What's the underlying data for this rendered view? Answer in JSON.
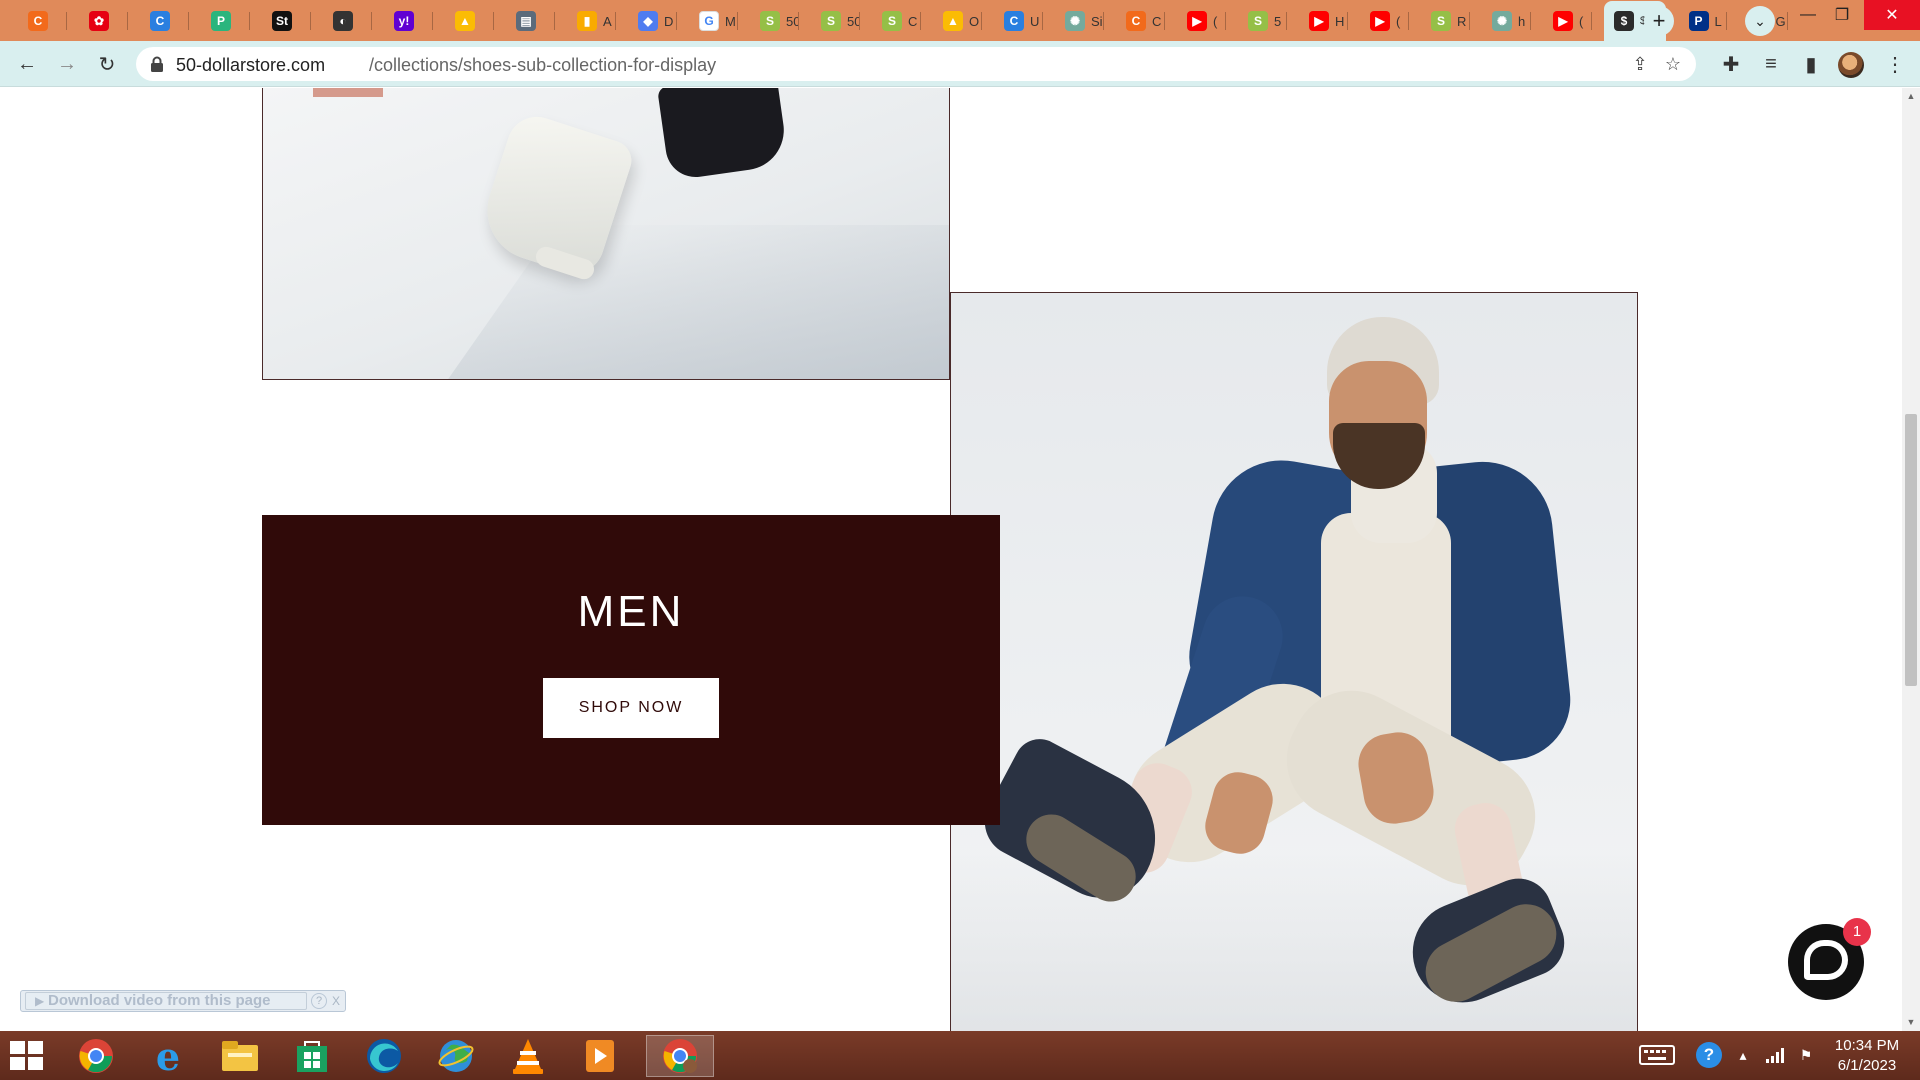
{
  "browser": {
    "tabs": [
      {
        "icon": "canva-icon",
        "title": "",
        "color": "#f26a1b",
        "glyph": "C"
      },
      {
        "icon": "huawei-icon",
        "title": "",
        "color": "#e60012",
        "glyph": "✿"
      },
      {
        "icon": "canva-icon",
        "title": "",
        "color": "#2a7fe0",
        "glyph": "C"
      },
      {
        "icon": "p-icon",
        "title": "",
        "color": "#2ab57d",
        "glyph": "P"
      },
      {
        "icon": "st-icon",
        "title": "",
        "color": "#111111",
        "glyph": "St"
      },
      {
        "icon": "globe-icon",
        "title": "",
        "color": "#333333",
        "glyph": "◐"
      },
      {
        "icon": "yahoo-icon",
        "title": "",
        "color": "#6001d2",
        "glyph": "y!"
      },
      {
        "icon": "google-ads-icon",
        "title": "",
        "color": "#fbbc04",
        "glyph": "▲"
      },
      {
        "icon": "calendar-icon",
        "title": "",
        "color": "#5b6b7b",
        "glyph": "▤"
      },
      {
        "icon": "analytics-icon",
        "title": "A",
        "color": "#f9ab00",
        "glyph": "▮"
      },
      {
        "icon": "tag-icon",
        "title": "D",
        "color": "#4f7cf0",
        "glyph": "◆"
      },
      {
        "icon": "google-icon",
        "title": "M",
        "color": "#ffffff",
        "glyph": "G"
      },
      {
        "icon": "shopify-icon",
        "title": "50",
        "color": "#95bf47",
        "glyph": "S"
      },
      {
        "icon": "shopify-icon",
        "title": "50",
        "color": "#95bf47",
        "glyph": "S"
      },
      {
        "icon": "shopify-icon",
        "title": "C",
        "color": "#95bf47",
        "glyph": "S"
      },
      {
        "icon": "google-ads-icon",
        "title": "O",
        "color": "#fbbc04",
        "glyph": "▲"
      },
      {
        "icon": "canva-icon",
        "title": "U",
        "color": "#2a7fe0",
        "glyph": "C"
      },
      {
        "icon": "openai-icon",
        "title": "Si",
        "color": "#74aa9c",
        "glyph": "✺"
      },
      {
        "icon": "canva-icon",
        "title": "C",
        "color": "#f26a1b",
        "glyph": "C"
      },
      {
        "icon": "youtube-icon",
        "title": "(",
        "color": "#ff0000",
        "glyph": "▶"
      },
      {
        "icon": "shopify-icon",
        "title": "5",
        "color": "#95bf47",
        "glyph": "S"
      },
      {
        "icon": "youtube-icon",
        "title": "H",
        "color": "#ff0000",
        "glyph": "▶"
      },
      {
        "icon": "youtube-icon",
        "title": "(",
        "color": "#ff0000",
        "glyph": "▶"
      },
      {
        "icon": "shopify-icon",
        "title": "R",
        "color": "#95bf47",
        "glyph": "S"
      },
      {
        "icon": "openai-icon",
        "title": "h",
        "color": "#74aa9c",
        "glyph": "✺"
      },
      {
        "icon": "youtube-icon",
        "title": "(",
        "color": "#ff0000",
        "glyph": "▶"
      },
      {
        "icon": "store-icon",
        "title": "$...",
        "color": "#2b2b2b",
        "glyph": "$",
        "active": true
      },
      {
        "icon": "paypal-icon",
        "title": "L",
        "color": "#003087",
        "glyph": "P"
      },
      {
        "icon": "openai-icon",
        "title": "G",
        "color": "#74aa9c",
        "glyph": "✺"
      }
    ],
    "url_host": "50-dollarstore.com",
    "url_path": "/collections/shoes-sub-collection-for-display"
  },
  "hero": {
    "title": "MEN",
    "button_label": "SHOP NOW"
  },
  "download_bar": {
    "label": "Download video from this page",
    "help": "?",
    "close": "X"
  },
  "chat": {
    "badge_count": "1"
  },
  "taskbar": {
    "apps": [
      "chrome-icon",
      "internet-explorer-icon",
      "file-explorer-icon",
      "store-icon",
      "edge-icon",
      "globe-app-icon",
      "vlc-icon",
      "video-player-icon",
      "chrome-active-icon"
    ],
    "time": "10:34 PM",
    "date": "6/1/2023"
  },
  "colors": {
    "tab_strip": "#e08a5a",
    "toolbar": "#d9efef",
    "hero_box": "#300a09",
    "taskbar": "#6a3122"
  }
}
